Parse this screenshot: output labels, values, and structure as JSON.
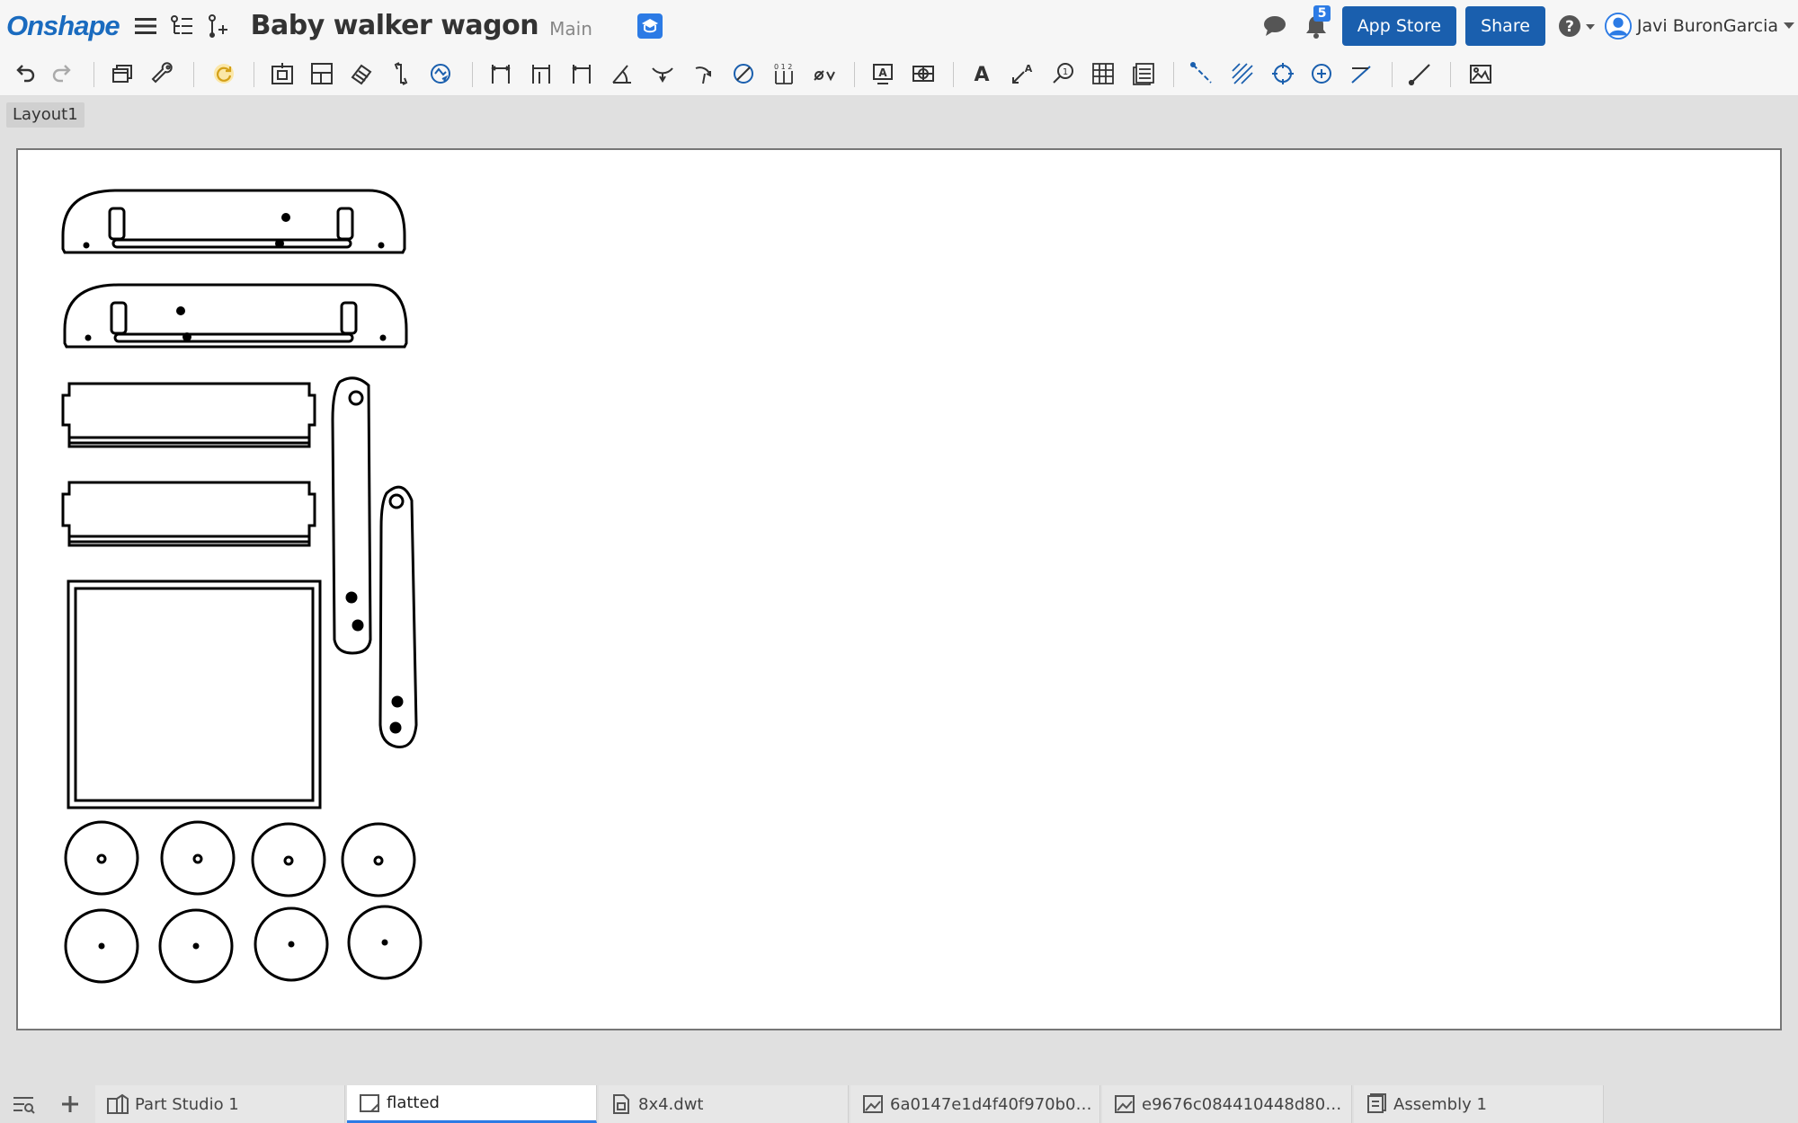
{
  "header": {
    "logo": "Onshape",
    "document_title": "Baby walker wagon",
    "branch": "Main",
    "notification_count": "5",
    "app_store_label": "App Store",
    "share_label": "Share",
    "help_label": "?",
    "user_name": "Javi BuronGarcia"
  },
  "toolbar": {
    "icons": [
      "undo-icon",
      "redo-icon",
      "sheet-properties-icon",
      "wrench-icon",
      "update-icon",
      "insert-view-icon",
      "projected-view-icon",
      "section-view-icon",
      "detail-view-icon",
      "auxiliary-view-icon",
      "linear-dimension-icon",
      "baseline-dimension-icon",
      "chain-dimension-icon",
      "angular-dimension-icon",
      "radial-dimension-icon",
      "arc-dimension-icon",
      "diameter-dimension-icon",
      "ordinate-dimension-icon",
      "gd-t-icon",
      "note-icon",
      "datum-icon",
      "text-icon",
      "leader-icon",
      "callout-icon",
      "table-icon",
      "bom-icon",
      "centerline-icon",
      "hatch-icon",
      "center-mark-icon",
      "circle-mark-icon",
      "line-icon",
      "measure-icon",
      "image-icon"
    ]
  },
  "sheet": {
    "layout_tab": "Layout1"
  },
  "tabs": [
    {
      "label": "Part Studio 1",
      "icon": "part-studio-icon",
      "active": false
    },
    {
      "label": "flatted",
      "icon": "drawing-icon",
      "active": true
    },
    {
      "label": "8x4.dwt",
      "icon": "file-icon",
      "active": false
    },
    {
      "label": "6a0147e1d4f40f970b01...",
      "icon": "image-icon",
      "active": false
    },
    {
      "label": "e9676c084410448d80d...",
      "icon": "image-icon",
      "active": false
    },
    {
      "label": "Assembly 1",
      "icon": "assembly-icon",
      "active": false
    }
  ],
  "colors": {
    "brand": "#1a6bbf",
    "button": "#1a5fae",
    "accent": "#2c7be5"
  }
}
